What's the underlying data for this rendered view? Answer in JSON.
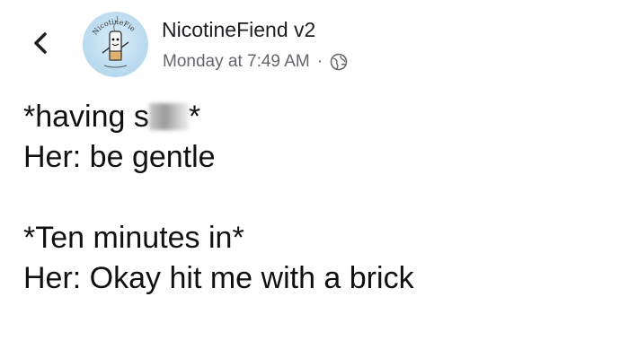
{
  "header": {
    "back_icon": "chevron-left-icon",
    "avatar_text": "NicotineFie",
    "author_name": "NicotineFiend v2",
    "timestamp": "Monday at 7:49 AM",
    "separator": "·",
    "audience_icon": "globe-icon"
  },
  "post": {
    "line1_prefix": "*having s",
    "line1_censored": "censored-blur",
    "line1_suffix": "*",
    "line2": "Her: be gentle",
    "line3": "*Ten minutes in*",
    "line4": "Her: Okay hit me with a brick"
  }
}
